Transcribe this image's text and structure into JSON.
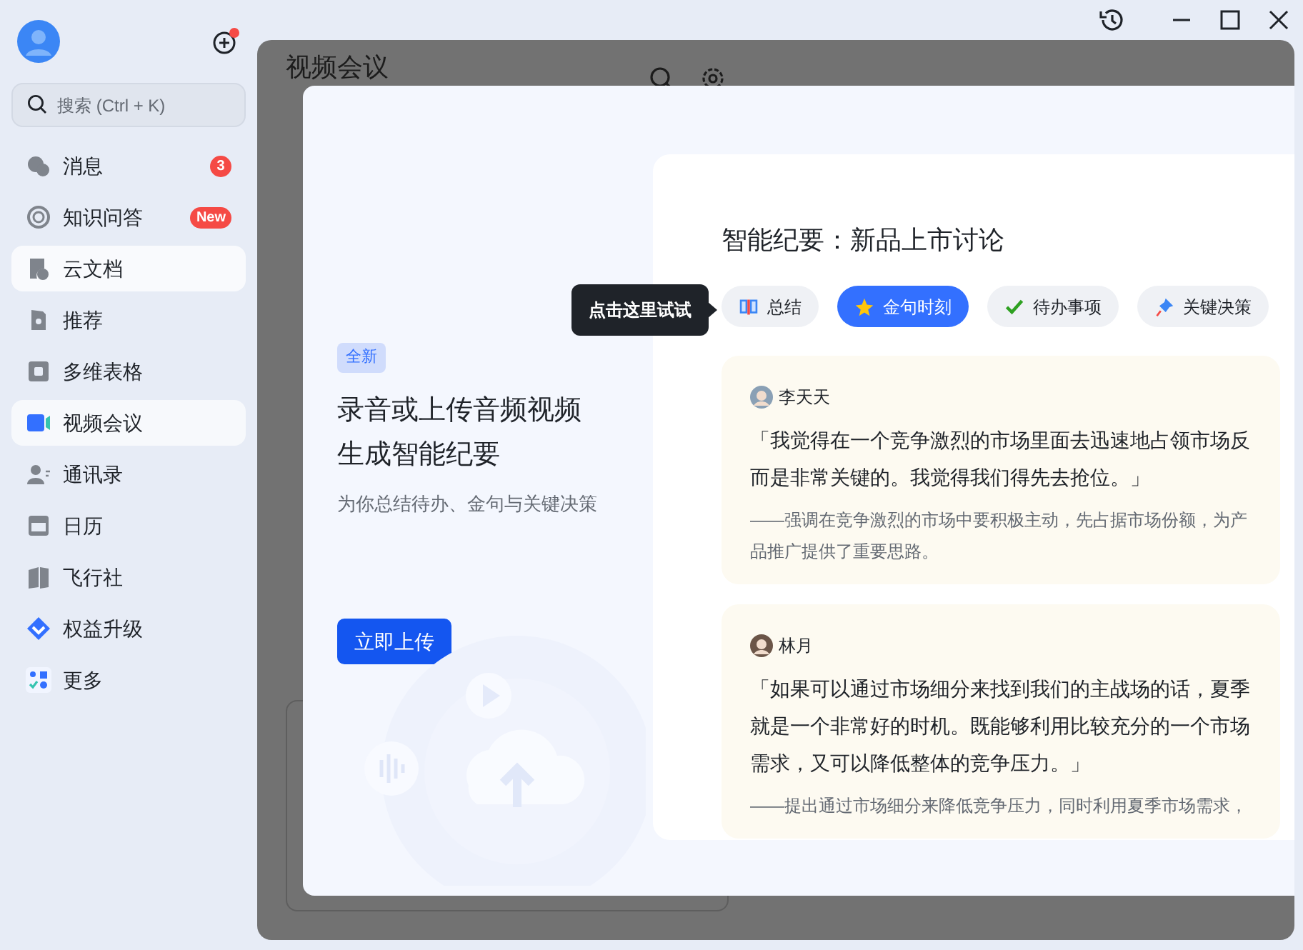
{
  "sidebar": {
    "search": {
      "placeholder": "搜索 (Ctrl + K)"
    },
    "items": [
      {
        "label": "消息",
        "badge": "3",
        "selected": false,
        "hovered": false
      },
      {
        "label": "知识问答",
        "badge": "New",
        "selected": false,
        "hovered": false
      },
      {
        "label": "云文档",
        "selected": false,
        "hovered": true
      },
      {
        "label": "推荐",
        "selected": false,
        "hovered": false
      },
      {
        "label": "多维表格",
        "selected": false,
        "hovered": false
      },
      {
        "label": "视频会议",
        "selected": true,
        "hovered": false
      },
      {
        "label": "通讯录",
        "selected": false,
        "hovered": false
      },
      {
        "label": "日历",
        "selected": false,
        "hovered": false
      },
      {
        "label": "飞行社",
        "selected": false,
        "hovered": false
      },
      {
        "label": "权益升级",
        "selected": false,
        "hovered": false
      },
      {
        "label": "更多",
        "selected": false,
        "hovered": false
      }
    ]
  },
  "page": {
    "title": "视频会议"
  },
  "dialog": {
    "badge": "全新",
    "title_lines": [
      "录音或上传音频视频",
      "生成智能纪要"
    ],
    "subtitle": "为你总结待办、金句与关键决策",
    "button": "立即上传",
    "tooltip": "点击这里试试",
    "preview": {
      "title": "智能纪要：新品上市讨论",
      "tabs": [
        {
          "label": "总结",
          "selected": false
        },
        {
          "label": "金句时刻",
          "selected": true
        },
        {
          "label": "待办事项",
          "selected": false
        },
        {
          "label": "关键决策",
          "selected": false
        }
      ],
      "quotes": [
        {
          "speaker": "李天天",
          "quote": "「我觉得在一个竞争激烈的市场里面去迅速地占领市场反而是非常关键的。我觉得我们得先去抢位。」",
          "comment": "——强调在竞争激烈的市场中要积极主动，先占据市场份额，为产品推广提供了重要思路。"
        },
        {
          "speaker": "林月",
          "quote": "「如果可以通过市场细分来找到我们的主战场的话，夏季就是一个非常好的时机。既能够利用比较充分的一个市场需求，又可以降低整体的竞争压力。」",
          "comment": "——提出通过市场细分来降低竞争压力，同时利用夏季市场需求，"
        }
      ]
    }
  }
}
